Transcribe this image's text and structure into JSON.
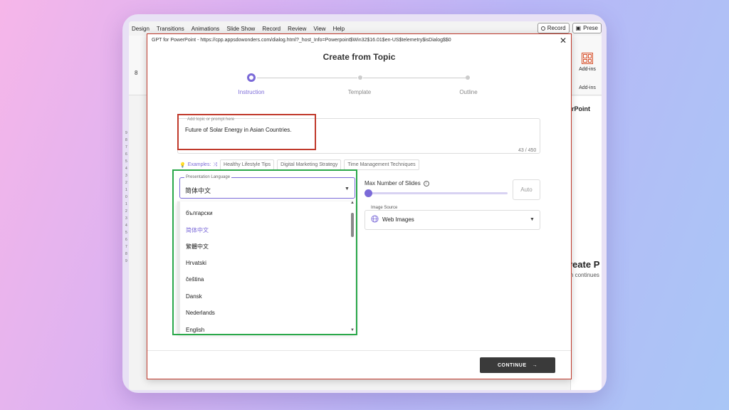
{
  "menubar": {
    "items": [
      "Design",
      "Transitions",
      "Animations",
      "Slide Show",
      "Record",
      "Review",
      "View",
      "Help"
    ],
    "record_label": "Record",
    "present_label": "Prese"
  },
  "ribbon": {
    "number": "8",
    "addins_label": "Add-ins",
    "addins_group": "Add-ins"
  },
  "side_panel": {
    "title": "verPoint",
    "create_text": "reate P",
    "continue_text": "n continues"
  },
  "ruler_marks": [
    "9",
    "8",
    "7",
    "6",
    "5",
    "4",
    "3",
    "2",
    "1",
    "0",
    "1",
    "2",
    "3",
    "4",
    "5",
    "6",
    "7",
    "8",
    "9"
  ],
  "dialog": {
    "window_title": "GPT for PowerPoint - https://cpp.appsdowonders.com/dialog.html?_host_Info=Powerpoint$Win32$16.01$en-US$telemetry$isDialog$$0",
    "close_glyph": "✕",
    "heading": "Create from Topic",
    "steps": [
      {
        "label": "Instruction",
        "active": true
      },
      {
        "label": "Template",
        "active": false
      },
      {
        "label": "Outline",
        "active": false
      }
    ],
    "topic": {
      "label": "Add topic or prompt here",
      "value": "Future of Solar Energy in Asian Countries.",
      "counter": "43 / 450"
    },
    "examples": {
      "label": "Examples:",
      "chips": [
        "Healthy Lifestyle Tips",
        "Digital Marketing Strategy",
        "Time Management Techniques"
      ]
    },
    "language": {
      "label": "Presentation Language",
      "value": "简体中文",
      "options": [
        "български",
        "简体中文",
        "繁體中文",
        "Hrvatski",
        "čeština",
        "Dansk",
        "Nederlands",
        "English"
      ],
      "selected_index": 1
    },
    "slides": {
      "label": "Max Number of Slides",
      "info_glyph": "i",
      "slider_level": 0,
      "auto_label": "Auto"
    },
    "image_source": {
      "label": "Image Source",
      "value": "Web Images"
    },
    "continue_label": "CONTINUE",
    "colors": {
      "accent": "#7b6ad8",
      "highlight_red": "#c0392b",
      "highlight_green": "#2aa84a",
      "button_dark": "#3a3a3a"
    }
  }
}
